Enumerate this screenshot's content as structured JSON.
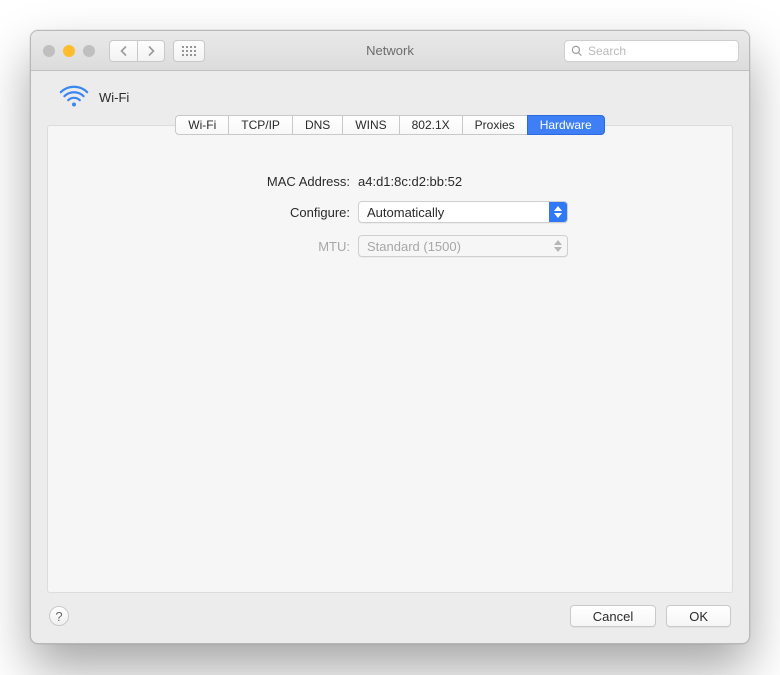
{
  "window": {
    "title": "Network",
    "search_placeholder": "Search"
  },
  "connection": {
    "name": "Wi-Fi"
  },
  "tabs": [
    {
      "label": "Wi-Fi",
      "active": false
    },
    {
      "label": "TCP/IP",
      "active": false
    },
    {
      "label": "DNS",
      "active": false
    },
    {
      "label": "WINS",
      "active": false
    },
    {
      "label": "802.1X",
      "active": false
    },
    {
      "label": "Proxies",
      "active": false
    },
    {
      "label": "Hardware",
      "active": true
    }
  ],
  "form": {
    "mac_address_label": "MAC Address:",
    "mac_address_value": "a4:d1:8c:d2:bb:52",
    "configure_label": "Configure:",
    "configure_value": "Automatically",
    "mtu_label": "MTU:",
    "mtu_value": "Standard  (1500)"
  },
  "footer": {
    "help": "?",
    "cancel": "Cancel",
    "ok": "OK"
  }
}
